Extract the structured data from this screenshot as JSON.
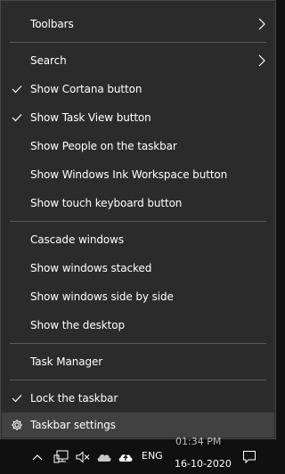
{
  "menu": {
    "items": [
      {
        "label": "Toolbars",
        "checked": false,
        "submenu": true
      },
      {
        "label": "Search",
        "checked": false,
        "submenu": true
      },
      {
        "label": "Show Cortana button",
        "checked": true,
        "submenu": false
      },
      {
        "label": "Show Task View button",
        "checked": true,
        "submenu": false
      },
      {
        "label": "Show People on the taskbar",
        "checked": false,
        "submenu": false
      },
      {
        "label": "Show Windows Ink Workspace button",
        "checked": false,
        "submenu": false
      },
      {
        "label": "Show touch keyboard button",
        "checked": false,
        "submenu": false
      },
      {
        "label": "Cascade windows",
        "checked": false,
        "submenu": false
      },
      {
        "label": "Show windows stacked",
        "checked": false,
        "submenu": false
      },
      {
        "label": "Show windows side by side",
        "checked": false,
        "submenu": false
      },
      {
        "label": "Show the desktop",
        "checked": false,
        "submenu": false
      },
      {
        "label": "Task Manager",
        "checked": false,
        "submenu": false
      },
      {
        "label": "Lock the taskbar",
        "checked": true,
        "submenu": false
      },
      {
        "label": "Taskbar settings",
        "icon": "gear-icon",
        "highlighted": true
      }
    ]
  },
  "taskbar": {
    "language": "ENG",
    "time": "01:34 PM",
    "date": "16-10-2020",
    "icons": [
      "chevron-up-icon",
      "network-icon",
      "volume-muted-icon",
      "onedrive-cloud-icon",
      "onedrive-upload-icon",
      "notification-icon"
    ]
  },
  "colors": {
    "menu_bg": "#2b2b2b",
    "highlight_bg": "#414141",
    "separator": "#5a5a5a",
    "text": "#ffffff",
    "taskbar_bg": "#101010"
  }
}
